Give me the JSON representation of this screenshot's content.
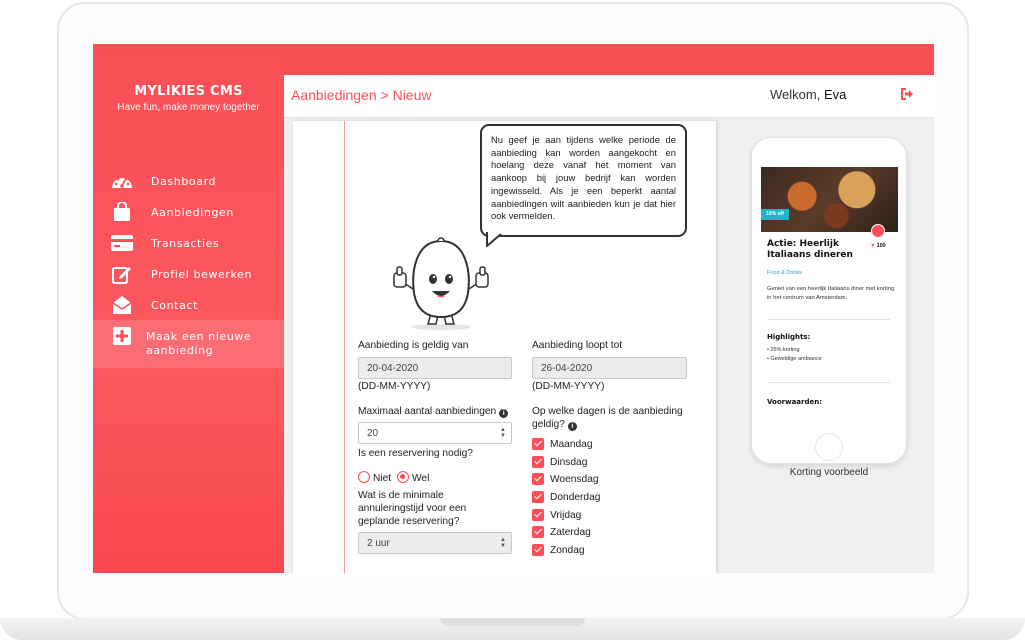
{
  "app": {
    "brand": "MYLIKIES CMS",
    "tagline": "Have fun, make money together",
    "accent_color": "#fb4f57"
  },
  "sidebar": {
    "items": [
      {
        "label": "Dashboard",
        "icon": "gauge-icon"
      },
      {
        "label": "Aanbiedingen",
        "icon": "shopping-bag-icon"
      },
      {
        "label": "Transacties",
        "icon": "credit-card-icon"
      },
      {
        "label": "Profiel bewerken",
        "icon": "edit-icon"
      },
      {
        "label": "Contact",
        "icon": "envelope-icon"
      },
      {
        "label": "Maak een nieuwe aanbieding",
        "icon": "plus-square-icon",
        "active": true
      }
    ]
  },
  "header": {
    "breadcrumb": "Aanbiedingen > Nieuw",
    "welcome_prefix": "Welkom,",
    "user_name": "Eva",
    "logout_icon": "logout-icon"
  },
  "form": {
    "tip": "Nu geef je aan tijdens welke periode de aanbieding kan worden aangekocht en hoelang deze vanaf het moment van aankoop bij jouw bedrijf kan worden ingewisseld. Als je een beperkt aantal aanbiedingen wilt aanbieden kun je dat hier ook vermelden.",
    "valid_from_label": "Aanbieding is geldig van",
    "valid_from_value": "20-04-2020",
    "valid_from_hint": "(DD-MM-YYYY)",
    "valid_to_label": "Aanbieding loopt tot",
    "valid_to_value": "26-04-2020",
    "valid_to_hint": "(DD-MM-YYYY)",
    "max_label": "Maximaal aantal aanbiedingen",
    "max_value": "20",
    "reservation_label": "Is een reservering nodig?",
    "reservation_options": [
      {
        "label": "Niet",
        "selected": false
      },
      {
        "label": "Wel",
        "selected": true
      }
    ],
    "cancel_label": "Wat is de minimale annuleringstijd voor een geplande reservering?",
    "cancel_value": "2 uur",
    "days_label": "Op welke dagen is de aanbieding geldig?",
    "days": [
      "Maandag",
      "Dinsdag",
      "Woensdag",
      "Donderdag",
      "Vrijdag",
      "Zaterdag",
      "Zondag"
    ]
  },
  "preview": {
    "discount_badge": "10% off",
    "title": "Actie: Heerlijk Italiaans dineren",
    "likes": "100",
    "category": "Food & Drinks",
    "description": "Geniet van een heerlijk Italiaans diner met korting in het centrum van Amsterdam.",
    "highlights_title": "Highlights:",
    "highlights": [
      "25% korting",
      "Geweldige ambiance"
    ],
    "conditions_title": "Voorwaarden:",
    "caption": "Korting voorbeeld"
  }
}
